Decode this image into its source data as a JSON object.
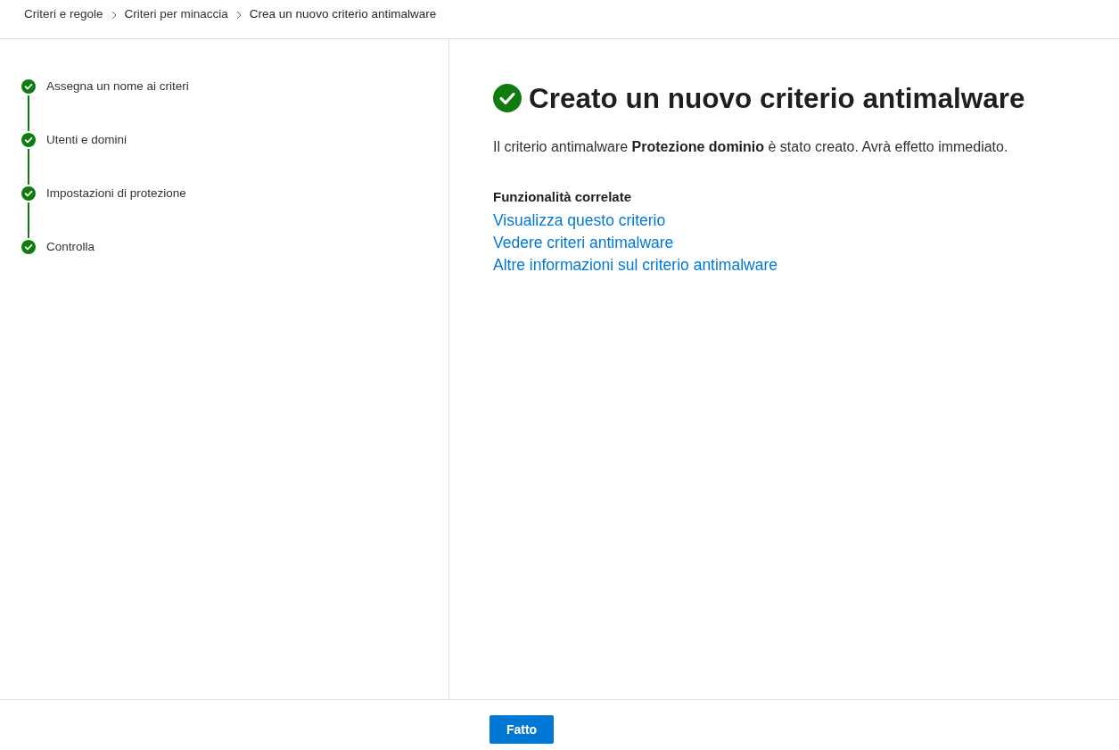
{
  "breadcrumb": [
    {
      "label": "Criteri e regole",
      "current": false
    },
    {
      "label": "Criteri per minaccia",
      "current": false
    },
    {
      "label": "Crea un nuovo criterio antimalware",
      "current": true
    }
  ],
  "steps": [
    {
      "label": "Assegna un nome ai criteri",
      "completed": true
    },
    {
      "label": "Utenti e domini",
      "completed": true
    },
    {
      "label": "Impostazioni di protezione",
      "completed": true
    },
    {
      "label": "Controlla",
      "completed": true
    }
  ],
  "result": {
    "title": "Creato un nuovo criterio antimalware",
    "message": "Il criterio antimalware **Protezione dominio** è stato creato. Avrà effetto immediato.",
    "related": {
      "heading": "Funzionalità correlate",
      "links": [
        "Visualizza questo criterio",
        "Vedere criteri antimalware",
        "Altre informazioni sul criterio antimalware"
      ]
    }
  },
  "footer": {
    "button": "Fatto"
  }
}
